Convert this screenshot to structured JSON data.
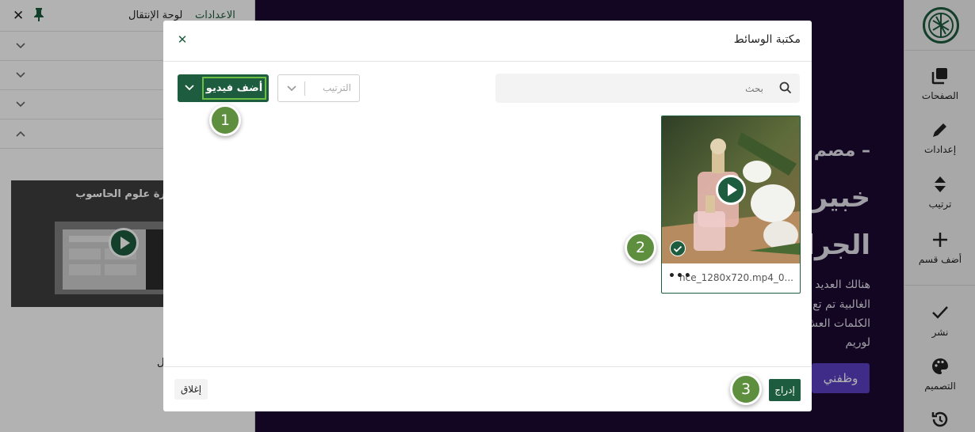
{
  "left_panel": {
    "tab_settings": "الاعدادات",
    "tab_navigator": "لوحة الإنتقال",
    "video_title": "ورة علوم الحاسوب",
    "hidden_label": "ل"
  },
  "right_sidebar": {
    "items": [
      {
        "label": "الصفحات",
        "icon": "pages-icon"
      },
      {
        "label": "إعدادات",
        "icon": "pencil-icon"
      },
      {
        "label": "ترتيب",
        "icon": "sort-icon"
      },
      {
        "label": "أضف قسم",
        "icon": "plus-icon"
      },
      {
        "label": "نشر",
        "icon": "check-icon"
      },
      {
        "label": "التصميم",
        "icon": "palette-icon"
      }
    ]
  },
  "page_bg": {
    "line1": "– مصم",
    "line2": "خبير ",
    "line3": "الجرا",
    "para1": "هنالك العديد",
    "para2": "الغالبية تم تع",
    "para3": "الكلمات العش",
    "para4": "لوريم",
    "cta": "وظفني"
  },
  "modal": {
    "title": "مكتبة الوسائط",
    "search_placeholder": "بحث",
    "sort_placeholder": "الترتيب",
    "add_video_label": "أضف فيديو",
    "media_item": {
      "filename": "nce_1280x720.mp4_0...",
      "selected": true
    },
    "close_button": "إغلاق",
    "insert_button": "إدراج"
  },
  "steps": [
    "1",
    "2",
    "3"
  ],
  "colors": {
    "brand_green": "#1d5c3e",
    "step_green": "#5e8f3e",
    "accent_light_green": "#6bbf45",
    "page_dark": "#1b0a33",
    "cta_purple": "#5b3fc4"
  }
}
